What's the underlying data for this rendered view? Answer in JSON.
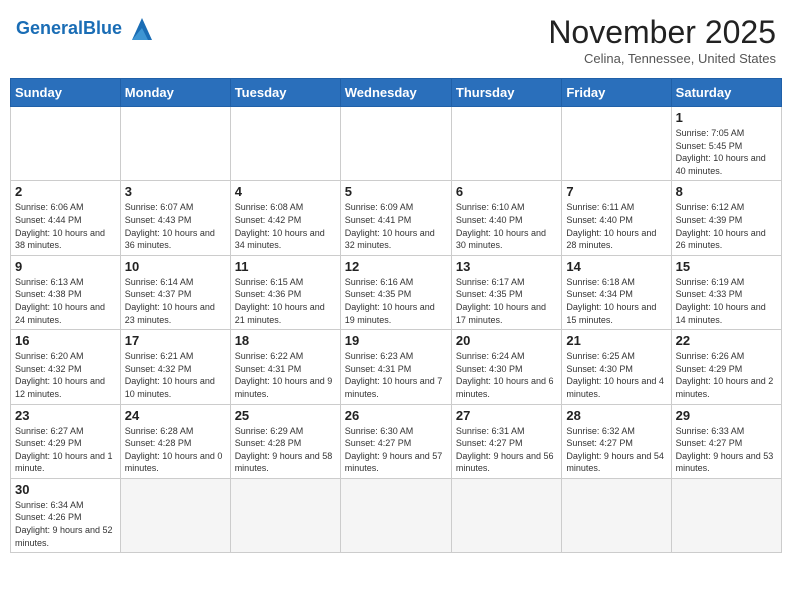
{
  "header": {
    "logo_general": "General",
    "logo_blue": "Blue",
    "title": "November 2025",
    "subtitle": "Celina, Tennessee, United States"
  },
  "weekdays": [
    "Sunday",
    "Monday",
    "Tuesday",
    "Wednesday",
    "Thursday",
    "Friday",
    "Saturday"
  ],
  "weeks": [
    [
      {
        "day": "",
        "info": ""
      },
      {
        "day": "",
        "info": ""
      },
      {
        "day": "",
        "info": ""
      },
      {
        "day": "",
        "info": ""
      },
      {
        "day": "",
        "info": ""
      },
      {
        "day": "",
        "info": ""
      },
      {
        "day": "1",
        "info": "Sunrise: 7:05 AM\nSunset: 5:45 PM\nDaylight: 10 hours and 40 minutes."
      }
    ],
    [
      {
        "day": "2",
        "info": "Sunrise: 6:06 AM\nSunset: 4:44 PM\nDaylight: 10 hours and 38 minutes."
      },
      {
        "day": "3",
        "info": "Sunrise: 6:07 AM\nSunset: 4:43 PM\nDaylight: 10 hours and 36 minutes."
      },
      {
        "day": "4",
        "info": "Sunrise: 6:08 AM\nSunset: 4:42 PM\nDaylight: 10 hours and 34 minutes."
      },
      {
        "day": "5",
        "info": "Sunrise: 6:09 AM\nSunset: 4:41 PM\nDaylight: 10 hours and 32 minutes."
      },
      {
        "day": "6",
        "info": "Sunrise: 6:10 AM\nSunset: 4:40 PM\nDaylight: 10 hours and 30 minutes."
      },
      {
        "day": "7",
        "info": "Sunrise: 6:11 AM\nSunset: 4:40 PM\nDaylight: 10 hours and 28 minutes."
      },
      {
        "day": "8",
        "info": "Sunrise: 6:12 AM\nSunset: 4:39 PM\nDaylight: 10 hours and 26 minutes."
      }
    ],
    [
      {
        "day": "9",
        "info": "Sunrise: 6:13 AM\nSunset: 4:38 PM\nDaylight: 10 hours and 24 minutes."
      },
      {
        "day": "10",
        "info": "Sunrise: 6:14 AM\nSunset: 4:37 PM\nDaylight: 10 hours and 23 minutes."
      },
      {
        "day": "11",
        "info": "Sunrise: 6:15 AM\nSunset: 4:36 PM\nDaylight: 10 hours and 21 minutes."
      },
      {
        "day": "12",
        "info": "Sunrise: 6:16 AM\nSunset: 4:35 PM\nDaylight: 10 hours and 19 minutes."
      },
      {
        "day": "13",
        "info": "Sunrise: 6:17 AM\nSunset: 4:35 PM\nDaylight: 10 hours and 17 minutes."
      },
      {
        "day": "14",
        "info": "Sunrise: 6:18 AM\nSunset: 4:34 PM\nDaylight: 10 hours and 15 minutes."
      },
      {
        "day": "15",
        "info": "Sunrise: 6:19 AM\nSunset: 4:33 PM\nDaylight: 10 hours and 14 minutes."
      }
    ],
    [
      {
        "day": "16",
        "info": "Sunrise: 6:20 AM\nSunset: 4:32 PM\nDaylight: 10 hours and 12 minutes."
      },
      {
        "day": "17",
        "info": "Sunrise: 6:21 AM\nSunset: 4:32 PM\nDaylight: 10 hours and 10 minutes."
      },
      {
        "day": "18",
        "info": "Sunrise: 6:22 AM\nSunset: 4:31 PM\nDaylight: 10 hours and 9 minutes."
      },
      {
        "day": "19",
        "info": "Sunrise: 6:23 AM\nSunset: 4:31 PM\nDaylight: 10 hours and 7 minutes."
      },
      {
        "day": "20",
        "info": "Sunrise: 6:24 AM\nSunset: 4:30 PM\nDaylight: 10 hours and 6 minutes."
      },
      {
        "day": "21",
        "info": "Sunrise: 6:25 AM\nSunset: 4:30 PM\nDaylight: 10 hours and 4 minutes."
      },
      {
        "day": "22",
        "info": "Sunrise: 6:26 AM\nSunset: 4:29 PM\nDaylight: 10 hours and 2 minutes."
      }
    ],
    [
      {
        "day": "23",
        "info": "Sunrise: 6:27 AM\nSunset: 4:29 PM\nDaylight: 10 hours and 1 minute."
      },
      {
        "day": "24",
        "info": "Sunrise: 6:28 AM\nSunset: 4:28 PM\nDaylight: 10 hours and 0 minutes."
      },
      {
        "day": "25",
        "info": "Sunrise: 6:29 AM\nSunset: 4:28 PM\nDaylight: 9 hours and 58 minutes."
      },
      {
        "day": "26",
        "info": "Sunrise: 6:30 AM\nSunset: 4:27 PM\nDaylight: 9 hours and 57 minutes."
      },
      {
        "day": "27",
        "info": "Sunrise: 6:31 AM\nSunset: 4:27 PM\nDaylight: 9 hours and 56 minutes."
      },
      {
        "day": "28",
        "info": "Sunrise: 6:32 AM\nSunset: 4:27 PM\nDaylight: 9 hours and 54 minutes."
      },
      {
        "day": "29",
        "info": "Sunrise: 6:33 AM\nSunset: 4:27 PM\nDaylight: 9 hours and 53 minutes."
      }
    ],
    [
      {
        "day": "30",
        "info": "Sunrise: 6:34 AM\nSunset: 4:26 PM\nDaylight: 9 hours and 52 minutes."
      },
      {
        "day": "",
        "info": ""
      },
      {
        "day": "",
        "info": ""
      },
      {
        "day": "",
        "info": ""
      },
      {
        "day": "",
        "info": ""
      },
      {
        "day": "",
        "info": ""
      },
      {
        "day": "",
        "info": ""
      }
    ]
  ]
}
